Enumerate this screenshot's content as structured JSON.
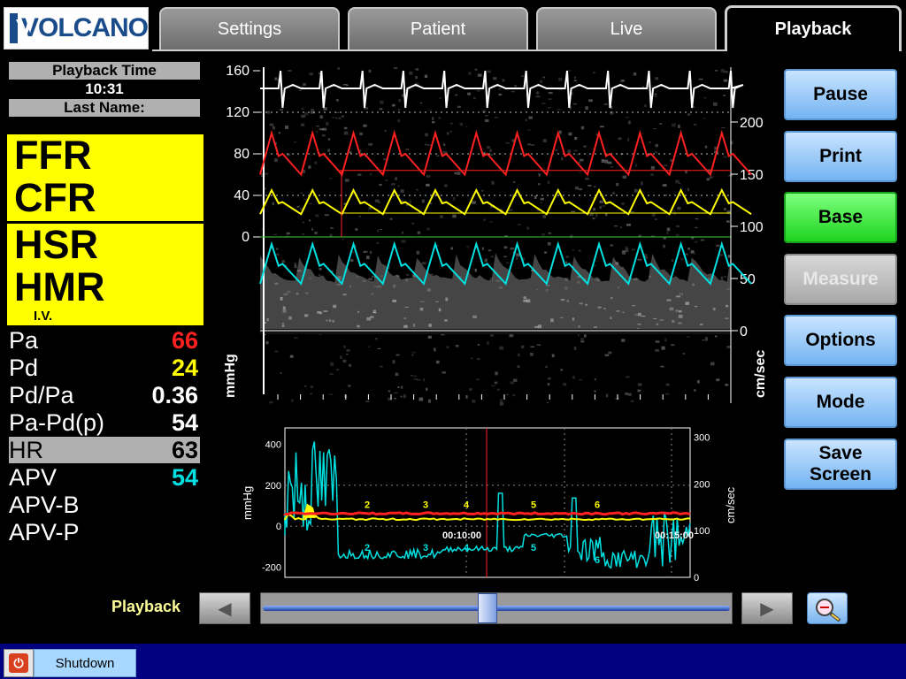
{
  "app": {
    "brand": "VOLCANO"
  },
  "tabs": [
    {
      "label": "Settings",
      "active": false
    },
    {
      "label": "Patient",
      "active": false
    },
    {
      "label": "Live",
      "active": false
    },
    {
      "label": "Playback",
      "active": true
    }
  ],
  "info": {
    "playback_time_label": "Playback Time",
    "playback_time": "10:31",
    "last_name_label": "Last Name:"
  },
  "indices": {
    "ffr": "FFR",
    "cfr": "CFR",
    "hsr": "HSR",
    "hmr": "HMR",
    "iv": "I.V."
  },
  "metrics": [
    {
      "label": "Pa",
      "value": "66",
      "color": "#ff2020",
      "highlight": false
    },
    {
      "label": "Pd",
      "value": "24",
      "color": "#ffff00",
      "highlight": false
    },
    {
      "label": "Pd/Pa",
      "value": "0.36",
      "color": "#ffffff",
      "highlight": false
    },
    {
      "label": "Pa-Pd(p)",
      "value": "54",
      "color": "#ffffff",
      "highlight": false
    },
    {
      "label": "HR",
      "value": "63",
      "color": "#000000",
      "highlight": true
    },
    {
      "label": "APV",
      "value": "54",
      "color": "#00e0e0",
      "highlight": false
    },
    {
      "label": "APV-B",
      "value": "",
      "color": "#ffffff",
      "highlight": false
    },
    {
      "label": "APV-P",
      "value": "",
      "color": "#ffffff",
      "highlight": false
    }
  ],
  "buttons": {
    "pause": "Pause",
    "print": "Print",
    "base": "Base",
    "measure": "Measure",
    "options": "Options",
    "mode": "Mode",
    "save_screen": "Save\nScreen"
  },
  "playback": {
    "label": "Playback",
    "position": 0.48
  },
  "taskbar": {
    "shutdown": "Shutdown"
  },
  "colors": {
    "ecg": "#ffffff",
    "pa": "#ff2020",
    "pd": "#ffff00",
    "apv": "#00e0e0",
    "accent_blue": "#74b4f2",
    "base_green": "#1fd41f"
  },
  "chart_data": [
    {
      "type": "line",
      "name": "waveform",
      "left_ticks": [
        "160",
        "120",
        "80",
        "40",
        "0"
      ],
      "left_unit": "mmHg",
      "ylim_left": [
        0,
        160
      ],
      "right_ticks": [
        "200",
        "150",
        "100",
        "50",
        "0"
      ],
      "right_unit": "cm/sec",
      "ylim_right": [
        0,
        200
      ],
      "beats": 12,
      "series": [
        {
          "name": "Pa",
          "color": "#ff2020",
          "peak": 100,
          "trough": 60
        },
        {
          "name": "Pd",
          "color": "#ffff00",
          "peak": 45,
          "trough": 22
        },
        {
          "name": "APV",
          "color": "#00e0e0",
          "peak": 83,
          "trough": 45
        }
      ]
    },
    {
      "type": "line",
      "name": "trend",
      "left_ticks": [
        "400",
        "200",
        "0",
        "-200"
      ],
      "left_unit": "mmHg",
      "ylim_left": [
        -250,
        480
      ],
      "right_ticks": [
        "300",
        "200",
        "100",
        "0"
      ],
      "right_unit": "cm/sec",
      "ylim_right": [
        0,
        320
      ],
      "time_labels": [
        "00:10:00",
        "00:15:00"
      ],
      "markers": [
        "2",
        "3",
        "4",
        "5",
        "6"
      ],
      "series": [
        {
          "name": "Pa",
          "color": "#ff2020",
          "level": 60
        },
        {
          "name": "Pd",
          "color": "#ffff00",
          "level": 30
        },
        {
          "name": "APV",
          "color": "#00e0e0",
          "level": -150
        }
      ]
    }
  ]
}
